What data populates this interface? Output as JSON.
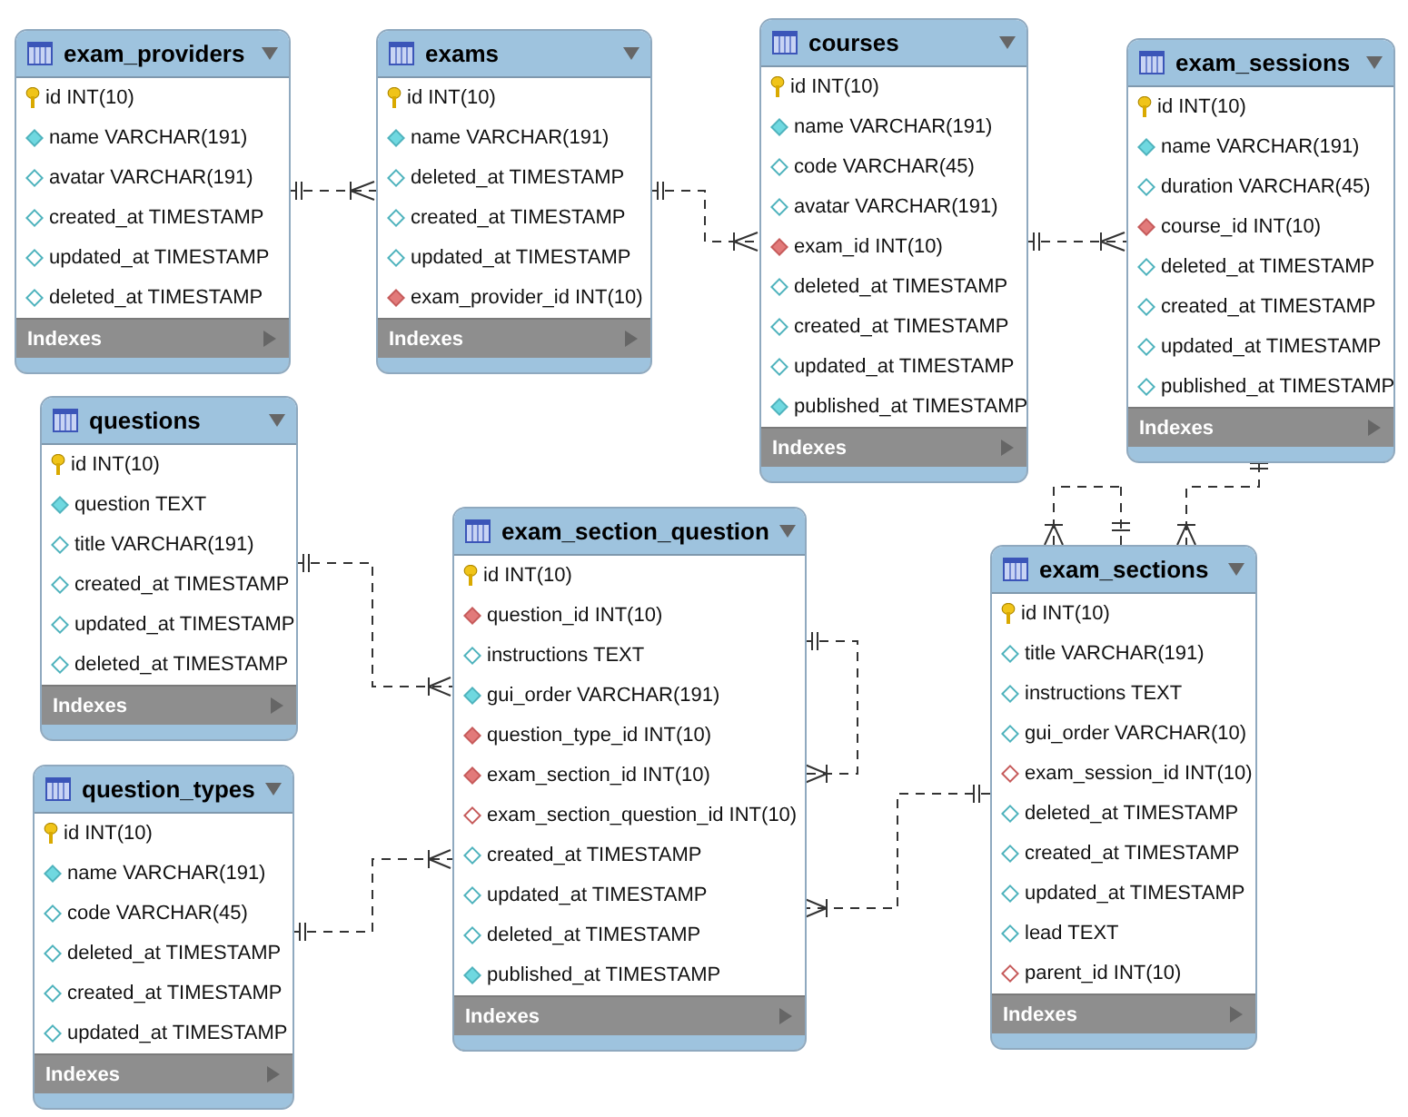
{
  "tables": [
    {
      "name": "exam_providers",
      "footer": "Indexes",
      "columns": [
        {
          "kind": "pk",
          "label": "id INT(10)"
        },
        {
          "kind": "required",
          "label": "name VARCHAR(191)"
        },
        {
          "kind": "optional",
          "label": "avatar VARCHAR(191)"
        },
        {
          "kind": "optional",
          "label": "created_at TIMESTAMP"
        },
        {
          "kind": "optional",
          "label": "updated_at TIMESTAMP"
        },
        {
          "kind": "optional",
          "label": "deleted_at TIMESTAMP"
        }
      ]
    },
    {
      "name": "exams",
      "footer": "Indexes",
      "columns": [
        {
          "kind": "pk",
          "label": "id INT(10)"
        },
        {
          "kind": "required",
          "label": "name VARCHAR(191)"
        },
        {
          "kind": "optional",
          "label": "deleted_at TIMESTAMP"
        },
        {
          "kind": "optional",
          "label": "created_at TIMESTAMP"
        },
        {
          "kind": "optional",
          "label": "updated_at TIMESTAMP"
        },
        {
          "kind": "fk",
          "label": "exam_provider_id INT(10)"
        }
      ]
    },
    {
      "name": "courses",
      "footer": "Indexes",
      "columns": [
        {
          "kind": "pk",
          "label": "id INT(10)"
        },
        {
          "kind": "required",
          "label": "name VARCHAR(191)"
        },
        {
          "kind": "optional",
          "label": "code VARCHAR(45)"
        },
        {
          "kind": "optional",
          "label": "avatar VARCHAR(191)"
        },
        {
          "kind": "fk",
          "label": "exam_id INT(10)"
        },
        {
          "kind": "optional",
          "label": "deleted_at TIMESTAMP"
        },
        {
          "kind": "optional",
          "label": "created_at TIMESTAMP"
        },
        {
          "kind": "optional",
          "label": "updated_at TIMESTAMP"
        },
        {
          "kind": "required",
          "label": "published_at TIMESTAMP"
        }
      ]
    },
    {
      "name": "exam_sessions",
      "footer": "Indexes",
      "columns": [
        {
          "kind": "pk",
          "label": "id INT(10)"
        },
        {
          "kind": "required",
          "label": "name VARCHAR(191)"
        },
        {
          "kind": "optional",
          "label": "duration VARCHAR(45)"
        },
        {
          "kind": "fk",
          "label": "course_id INT(10)"
        },
        {
          "kind": "optional",
          "label": "deleted_at TIMESTAMP"
        },
        {
          "kind": "optional",
          "label": "created_at TIMESTAMP"
        },
        {
          "kind": "optional",
          "label": "updated_at TIMESTAMP"
        },
        {
          "kind": "optional",
          "label": "published_at TIMESTAMP"
        }
      ]
    },
    {
      "name": "questions",
      "footer": "Indexes",
      "columns": [
        {
          "kind": "pk",
          "label": "id INT(10)"
        },
        {
          "kind": "required",
          "label": "question TEXT"
        },
        {
          "kind": "optional",
          "label": "title VARCHAR(191)"
        },
        {
          "kind": "optional",
          "label": "created_at TIMESTAMP"
        },
        {
          "kind": "optional",
          "label": "updated_at TIMESTAMP"
        },
        {
          "kind": "optional",
          "label": "deleted_at TIMESTAMP"
        }
      ]
    },
    {
      "name": "question_types",
      "footer": "Indexes",
      "columns": [
        {
          "kind": "pk",
          "label": "id INT(10)"
        },
        {
          "kind": "required",
          "label": "name VARCHAR(191)"
        },
        {
          "kind": "optional",
          "label": "code VARCHAR(45)"
        },
        {
          "kind": "optional",
          "label": "deleted_at TIMESTAMP"
        },
        {
          "kind": "optional",
          "label": "created_at TIMESTAMP"
        },
        {
          "kind": "optional",
          "label": "updated_at TIMESTAMP"
        }
      ]
    },
    {
      "name": "exam_section_question",
      "footer": "Indexes",
      "columns": [
        {
          "kind": "pk",
          "label": "id INT(10)"
        },
        {
          "kind": "fk",
          "label": "question_id INT(10)"
        },
        {
          "kind": "optional",
          "label": "instructions TEXT"
        },
        {
          "kind": "required",
          "label": "gui_order VARCHAR(191)"
        },
        {
          "kind": "fk",
          "label": "question_type_id INT(10)"
        },
        {
          "kind": "fk",
          "label": "exam_section_id INT(10)"
        },
        {
          "kind": "fk_optional",
          "label": "exam_section_question_id INT(10)"
        },
        {
          "kind": "optional",
          "label": "created_at TIMESTAMP"
        },
        {
          "kind": "optional",
          "label": "updated_at TIMESTAMP"
        },
        {
          "kind": "optional",
          "label": "deleted_at TIMESTAMP"
        },
        {
          "kind": "required",
          "label": "published_at TIMESTAMP"
        }
      ]
    },
    {
      "name": "exam_sections",
      "footer": "Indexes",
      "columns": [
        {
          "kind": "pk",
          "label": "id INT(10)"
        },
        {
          "kind": "optional",
          "label": "title VARCHAR(191)"
        },
        {
          "kind": "optional",
          "label": "instructions TEXT"
        },
        {
          "kind": "optional",
          "label": "gui_order VARCHAR(10)"
        },
        {
          "kind": "fk_optional",
          "label": "exam_session_id INT(10)"
        },
        {
          "kind": "optional",
          "label": "deleted_at TIMESTAMP"
        },
        {
          "kind": "optional",
          "label": "created_at TIMESTAMP"
        },
        {
          "kind": "optional",
          "label": "updated_at TIMESTAMP"
        },
        {
          "kind": "optional",
          "label": "lead TEXT"
        },
        {
          "kind": "fk_optional",
          "label": "parent_id INT(10)"
        }
      ]
    }
  ]
}
